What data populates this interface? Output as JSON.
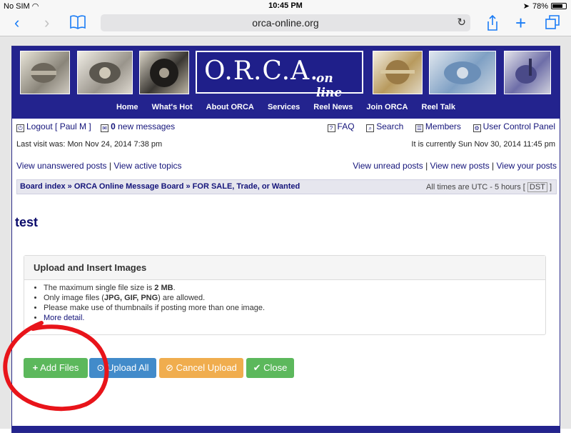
{
  "status_bar": {
    "carrier": "No SIM",
    "time": "10:45 PM",
    "battery": "78%",
    "battery_level": 0.78
  },
  "browser": {
    "url": "orca-online.org"
  },
  "header": {
    "logo_main": "O.R.C.A.",
    "logo_sub": "on line",
    "nav": [
      "Home",
      "What's Hot",
      "About ORCA",
      "Services",
      "Reel News",
      "Join ORCA",
      "Reel Talk"
    ]
  },
  "user_bar": {
    "logout": "Logout [ Paul M ]",
    "messages_count": "0",
    "messages_label": "new messages",
    "faq": "FAQ",
    "search": "Search",
    "members": "Members",
    "ucp": "User Control Panel"
  },
  "visit": {
    "last_visit": "Last visit was: Mon Nov 24, 2014 7:38 pm",
    "current_time": "It is currently Sun Nov 30, 2014 11:45 pm"
  },
  "quick_links": {
    "unanswered": "View unanswered posts",
    "active": "View active topics",
    "unread": "View unread posts",
    "new_posts": "View new posts",
    "your_posts": "View your posts"
  },
  "breadcrumb": {
    "items": [
      "Board index",
      "ORCA Online Message Board",
      "FOR SALE, Trade, or Wanted"
    ],
    "timezone_prefix": "All times are UTC - 5 hours [",
    "dst": "DST",
    "timezone_suffix": "]"
  },
  "topic": {
    "title": "test"
  },
  "upload_panel": {
    "title": "Upload and Insert Images",
    "line1_prefix": "The maximum single file size is",
    "line1_value": "2 MB",
    "line2_prefix": "Only image files (",
    "line2_value": "JPG, GIF, PNG",
    "line2_suffix": ") are allowed.",
    "line3": "Please make use of thumbnails if posting more than one image.",
    "line4": "More detail."
  },
  "buttons": {
    "add_files": "Add Files",
    "upload_all": "Upload All",
    "cancel_upload": "Cancel Upload",
    "close": "Close"
  },
  "colors": {
    "header_blue": "#23238e",
    "link_blue": "#14147a",
    "annotation_red": "#e8141a",
    "btn_green": "#5cb85c",
    "btn_blue": "#428bca",
    "btn_orange": "#f0ad4e"
  }
}
